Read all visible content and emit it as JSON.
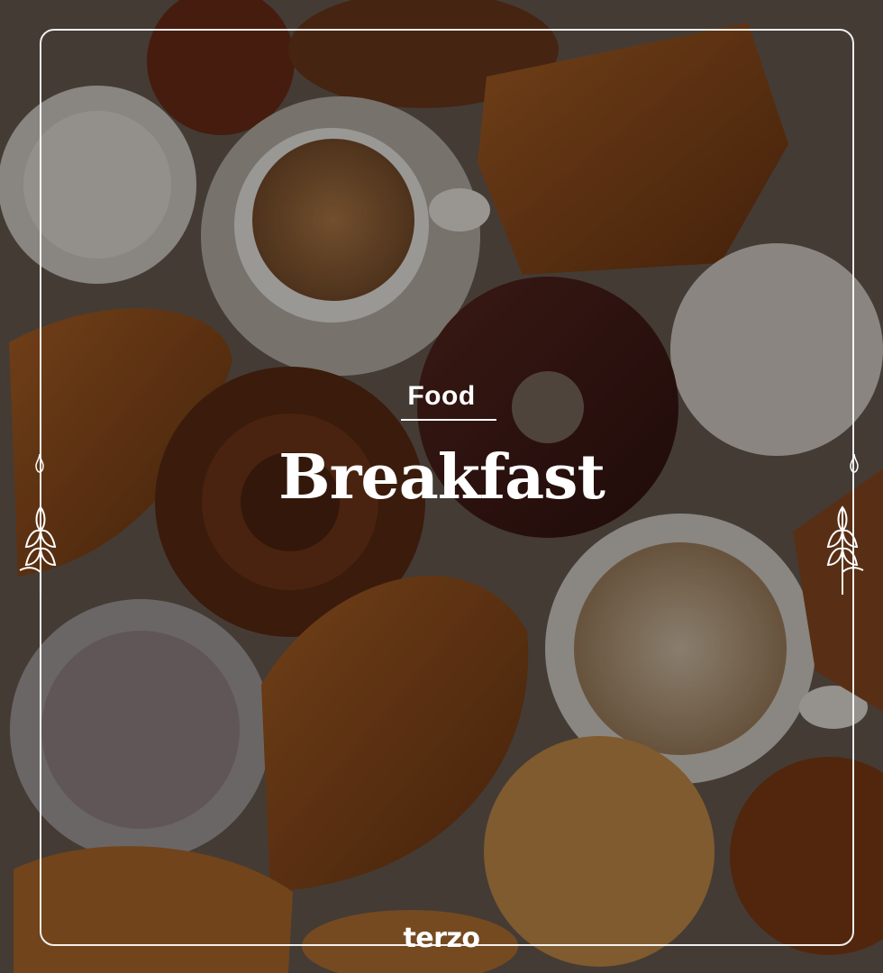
{
  "card": {
    "category": "Food",
    "title": "Breakfast",
    "brand": "terzo"
  },
  "icons": {
    "left_ornament": "wheat-sprig-icon",
    "right_ornament": "wheat-sprig-icon",
    "logo": "terzo-logo"
  },
  "colors": {
    "text": "#ffffff",
    "frame": "#ffffff",
    "background": "#5c5148"
  }
}
